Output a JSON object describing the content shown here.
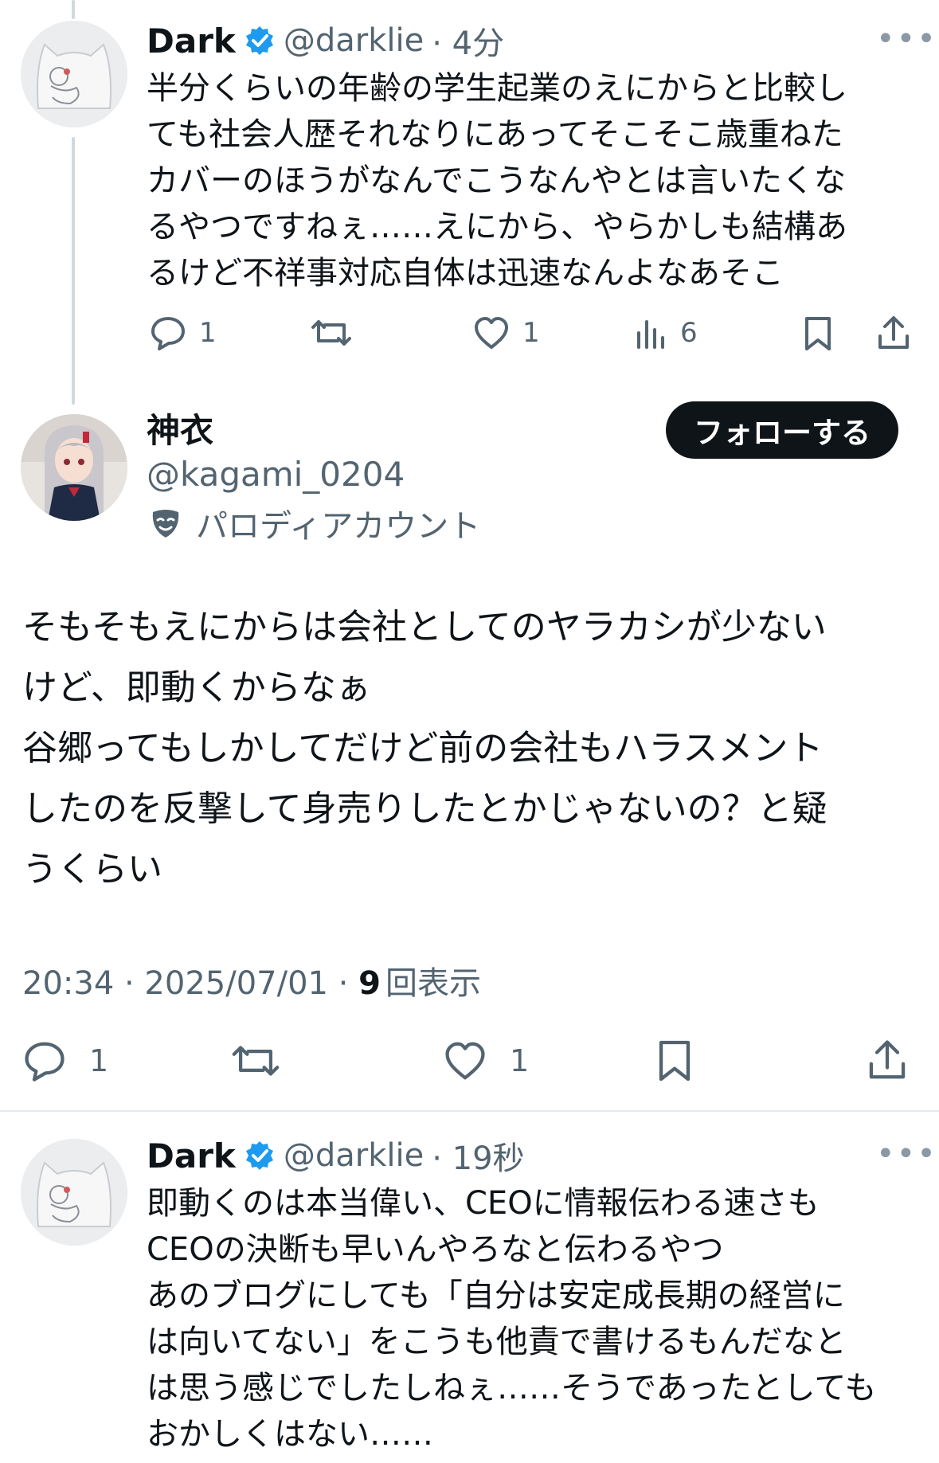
{
  "tweet1": {
    "name": "Dark",
    "handle": "@darklie",
    "time": "· 4分",
    "more": "•••",
    "text": "半分くらいの年齢の学生起業のえにからと比較し\nても社会人歴それなりにあってそこそこ歳重ねた\nカバーのほうがなんでこうなんやとは言いたくな\nるやつですねぇ……えにから、やらかしも結構あ\nるけど不祥事対応自体は迅速なんよなあそこ",
    "replies": "1",
    "likes": "1",
    "views": "6"
  },
  "main_tweet": {
    "name": "神衣",
    "handle": "@kagami_0204",
    "parody_label": "パロディアカウント",
    "follow_label": "フォローする",
    "text": "そもそもえにからは会社としてのヤラカシが少ない\nけど、即動くからなぁ\n谷郷ってもしかしてだけど前の会社もハラスメント\nしたのを反撃して身売りしたとかじゃないの？と疑\nうくらい",
    "timestamp": "20:34 · 2025/07/01 · ",
    "view_count": "9",
    "view_label": "回表示",
    "replies": "1",
    "likes": "1"
  },
  "tweet3": {
    "name": "Dark",
    "handle": "@darklie",
    "time": "· 19秒",
    "more": "•••",
    "text": "即動くのは本当偉い、CEOに情報伝わる速さも\nCEOの決断も早いんやろなと伝わるやつ\nあのブログにしても「自分は安定成長期の経営に\nは向いてない」をこうも他責で書けるもんだなと\nは思う感じでしたしねぇ……そうであったとしても\nおかしくはない……"
  },
  "colors": {
    "text": "#0f1419",
    "secondary": "#536471",
    "verified": "#1d9bf0",
    "divider": "#e6e9eb"
  }
}
